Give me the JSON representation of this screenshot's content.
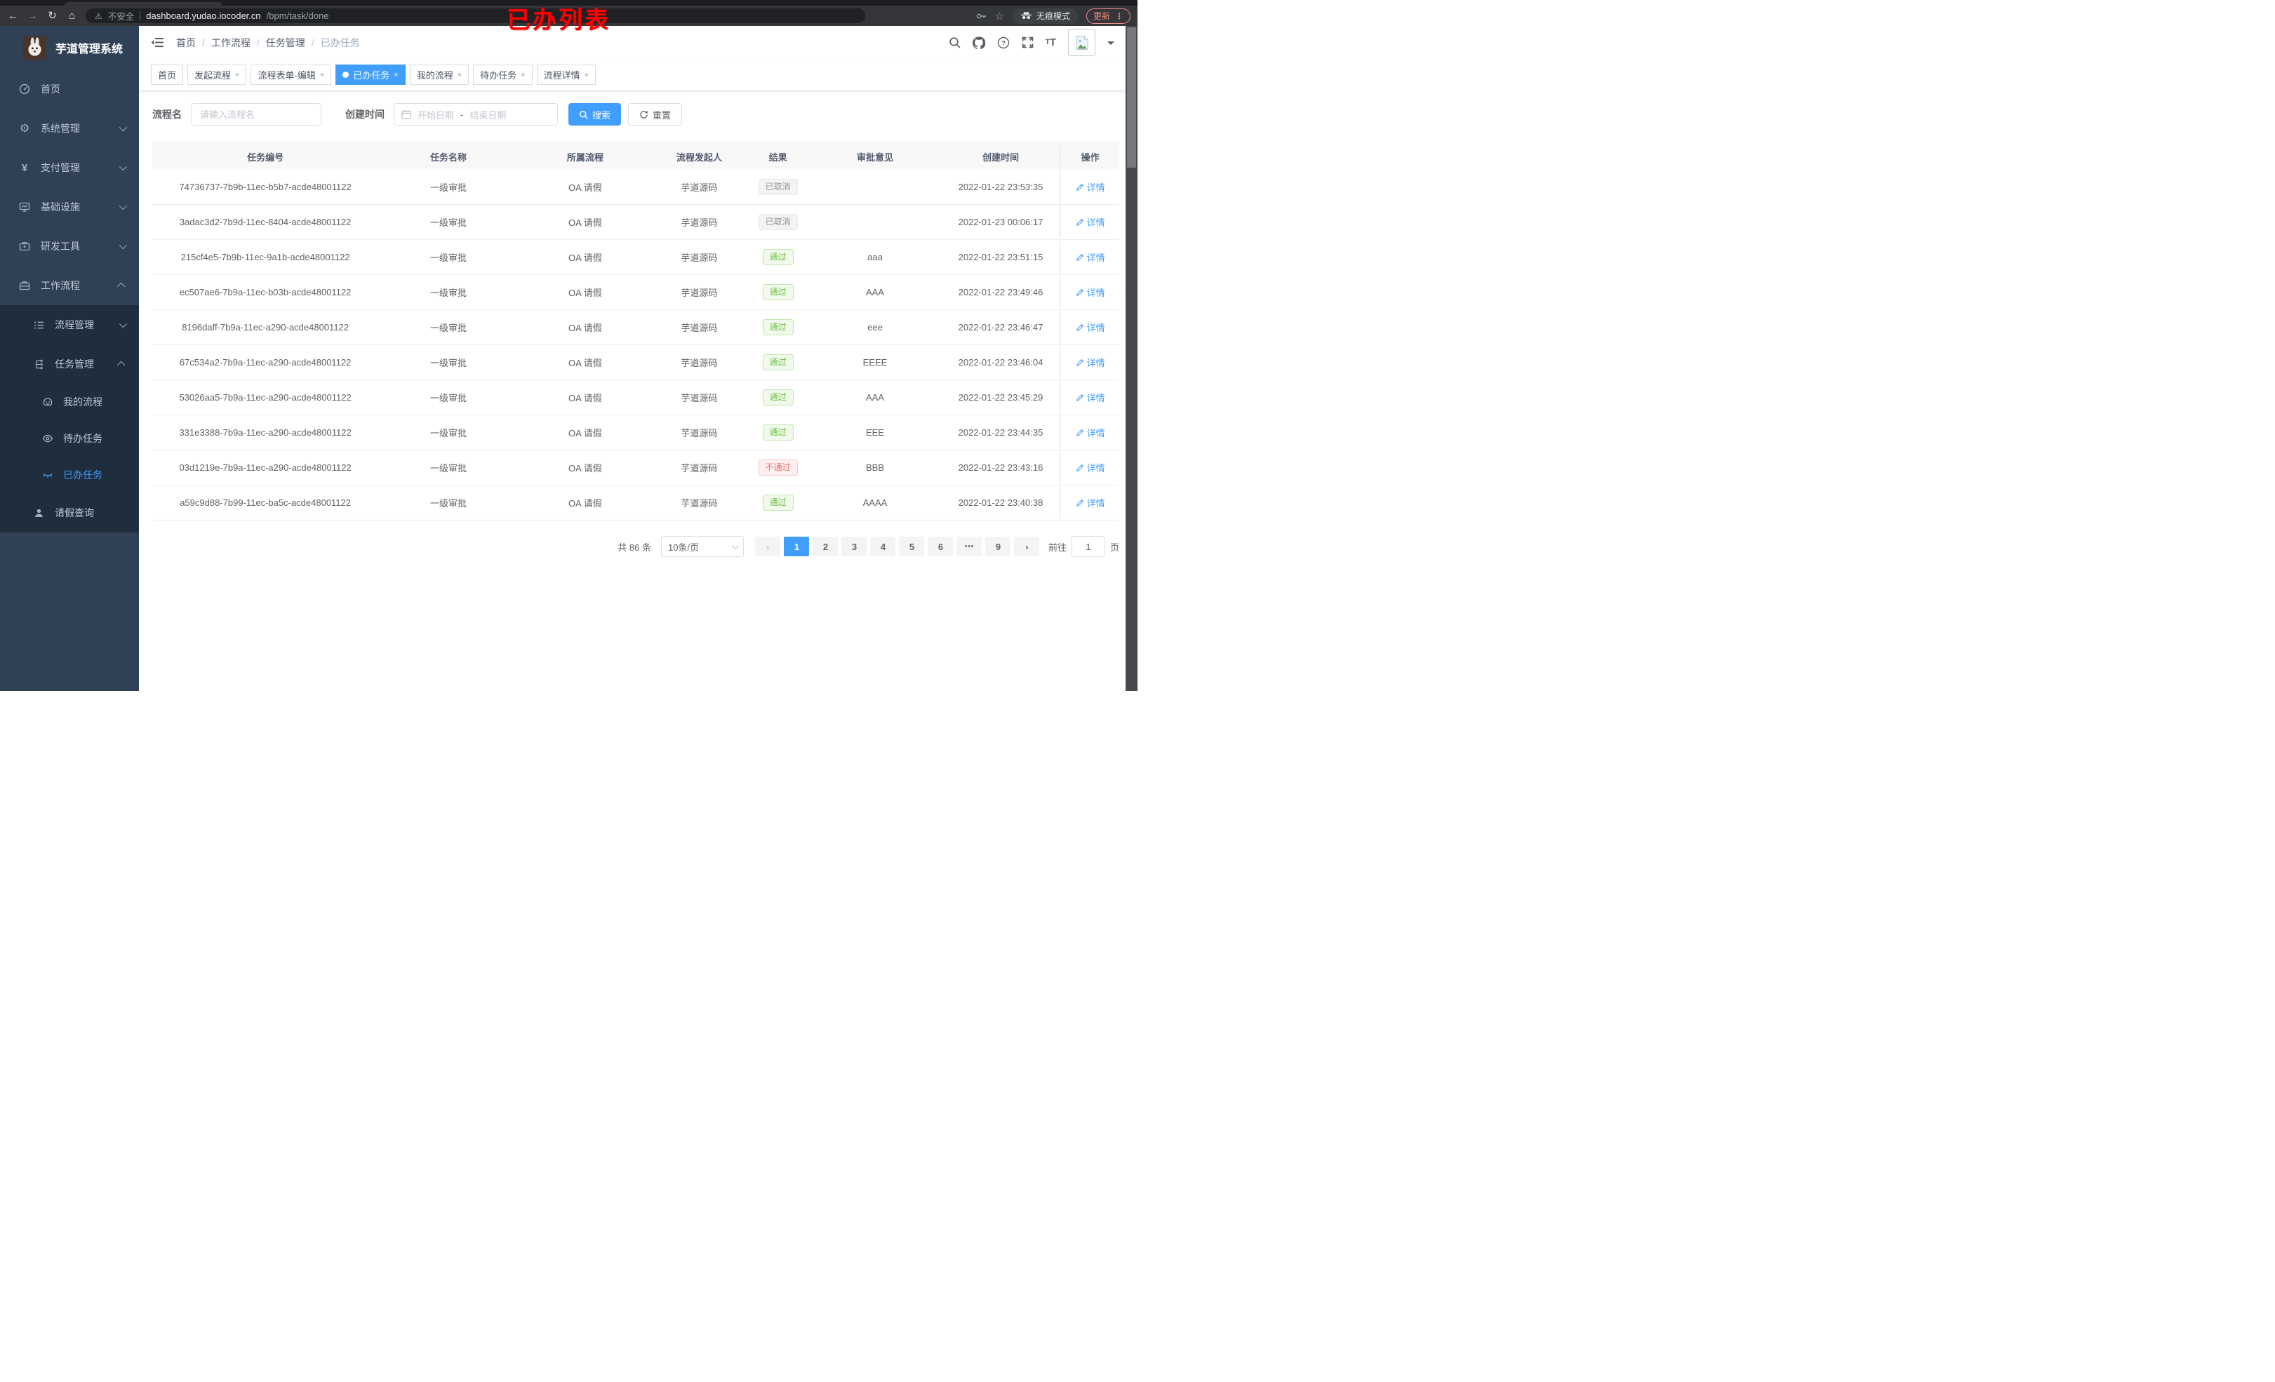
{
  "annotation": {
    "text": "已办列表",
    "color": "#fe0000"
  },
  "browser": {
    "security_label": "不安全",
    "url_host": "dashboard.yudao.iocoder.cn",
    "url_path": "/bpm/task/done",
    "incognito_label": "无痕模式",
    "update_label": "更新",
    "icons": [
      "back-icon",
      "forward-icon",
      "reload-icon",
      "home-icon",
      "warning-icon",
      "key-icon",
      "star-icon",
      "incognito-icon",
      "more-vert-icon"
    ]
  },
  "sidebar": {
    "title": "芋道管理系统",
    "logo_icon": "rabbit-avatar",
    "items": [
      {
        "label": "首页",
        "icon": "dashboard-icon"
      },
      {
        "label": "系统管理",
        "icon": "gear-icon",
        "chevron": "down"
      },
      {
        "label": "支付管理",
        "icon": "yen-icon",
        "chevron": "down"
      },
      {
        "label": "基础设施",
        "icon": "monitor-icon",
        "chevron": "down"
      },
      {
        "label": "研发工具",
        "icon": "toolbox-icon",
        "chevron": "down"
      },
      {
        "label": "工作流程",
        "icon": "briefcase-icon",
        "chevron": "up"
      }
    ],
    "workflow_submenu": {
      "process_mgmt": {
        "label": "流程管理",
        "icon": "list-icon",
        "chevron": "down"
      },
      "task_mgmt": {
        "label": "任务管理",
        "icon": "tree-icon",
        "chevron": "up"
      },
      "task_children": [
        {
          "label": "我的流程",
          "icon": "robot-icon"
        },
        {
          "label": "待办任务",
          "icon": "eye-icon"
        },
        {
          "label": "已办任务",
          "icon": "eye-closed-icon",
          "active": true
        }
      ],
      "leave_query": {
        "label": "请假查询",
        "icon": "user-icon"
      }
    }
  },
  "header": {
    "breadcrumb": {
      "items": [
        "首页",
        "工作流程",
        "任务管理",
        "已办任务"
      ],
      "separator": "/"
    },
    "icons": [
      "search-icon",
      "github-icon",
      "question-icon",
      "fullscreen-icon",
      "font-size-icon",
      "avatar-broken-image",
      "caret-down-icon"
    ]
  },
  "tabbar": {
    "close_glyph": "×",
    "tabs": [
      {
        "label": "首页",
        "closable": false,
        "active": false
      },
      {
        "label": "发起流程",
        "closable": true,
        "active": false
      },
      {
        "label": "流程表单-编辑",
        "closable": true,
        "active": false
      },
      {
        "label": "已办任务",
        "closable": true,
        "active": true
      },
      {
        "label": "我的流程",
        "closable": true,
        "active": false
      },
      {
        "label": "待办任务",
        "closable": true,
        "active": false
      },
      {
        "label": "流程详情",
        "closable": true,
        "active": false
      }
    ]
  },
  "search": {
    "name_label": "流程名",
    "name_placeholder": "请输入流程名",
    "time_label": "创建时间",
    "start_placeholder": "开始日期",
    "range_separator": "-",
    "end_placeholder": "结束日期",
    "search_label": "搜索",
    "reset_label": "重置",
    "search_icon": "search-icon",
    "reset_icon": "refresh-icon",
    "date_icon": "calendar-icon"
  },
  "table": {
    "columns": [
      "任务编号",
      "任务名称",
      "所属流程",
      "流程发起人",
      "结果",
      "审批意见",
      "创建时间",
      "操作"
    ],
    "action_label": "详情",
    "action_icon": "edit-pencil-icon",
    "result_colors": {
      "success": "#67c23a",
      "info": "#909399",
      "danger": "#f56c6c"
    },
    "rows": [
      {
        "id": "74736737-7b9b-11ec-b5b7-acde48001122",
        "name": "一级审批",
        "flow": "OA 请假",
        "starter": "芋道源码",
        "result": "已取消",
        "result_type": "info",
        "comment": "",
        "time": "2022-01-22 23:53:35"
      },
      {
        "id": "3adac3d2-7b9d-11ec-8404-acde48001122",
        "name": "一级审批",
        "flow": "OA 请假",
        "starter": "芋道源码",
        "result": "已取消",
        "result_type": "info",
        "comment": "",
        "time": "2022-01-23 00:06:17"
      },
      {
        "id": "215cf4e5-7b9b-11ec-9a1b-acde48001122",
        "name": "一级审批",
        "flow": "OA 请假",
        "starter": "芋道源码",
        "result": "通过",
        "result_type": "success",
        "comment": "aaa",
        "time": "2022-01-22 23:51:15"
      },
      {
        "id": "ec507ae6-7b9a-11ec-b03b-acde48001122",
        "name": "一级审批",
        "flow": "OA 请假",
        "starter": "芋道源码",
        "result": "通过",
        "result_type": "success",
        "comment": "AAA",
        "time": "2022-01-22 23:49:46"
      },
      {
        "id": "8196daff-7b9a-11ec-a290-acde48001122",
        "name": "一级审批",
        "flow": "OA 请假",
        "starter": "芋道源码",
        "result": "通过",
        "result_type": "success",
        "comment": "eee",
        "time": "2022-01-22 23:46:47"
      },
      {
        "id": "67c534a2-7b9a-11ec-a290-acde48001122",
        "name": "一级审批",
        "flow": "OA 请假",
        "starter": "芋道源码",
        "result": "通过",
        "result_type": "success",
        "comment": "EEEE",
        "time": "2022-01-22 23:46:04"
      },
      {
        "id": "53026aa5-7b9a-11ec-a290-acde48001122",
        "name": "一级审批",
        "flow": "OA 请假",
        "starter": "芋道源码",
        "result": "通过",
        "result_type": "success",
        "comment": "AAA",
        "time": "2022-01-22 23:45:29"
      },
      {
        "id": "331e3388-7b9a-11ec-a290-acde48001122",
        "name": "一级审批",
        "flow": "OA 请假",
        "starter": "芋道源码",
        "result": "通过",
        "result_type": "success",
        "comment": "EEE",
        "time": "2022-01-22 23:44:35"
      },
      {
        "id": "03d1219e-7b9a-11ec-a290-acde48001122",
        "name": "一级审批",
        "flow": "OA 请假",
        "starter": "芋道源码",
        "result": "不通过",
        "result_type": "danger",
        "comment": "BBB",
        "time": "2022-01-22 23:43:16"
      },
      {
        "id": "a59c9d88-7b99-11ec-ba5c-acde48001122",
        "name": "一级审批",
        "flow": "OA 请假",
        "starter": "芋道源码",
        "result": "通过",
        "result_type": "success",
        "comment": "AAAA",
        "time": "2022-01-22 23:40:38"
      }
    ]
  },
  "pagination": {
    "total": "共 86 条",
    "page_size": "10条/页",
    "prev": "‹",
    "next": "›",
    "pages": [
      "1",
      "2",
      "3",
      "4",
      "5",
      "6",
      "•••",
      "9"
    ],
    "active_page": "1",
    "goto_label": "前往",
    "goto_value": "1",
    "goto_suffix": "页"
  }
}
